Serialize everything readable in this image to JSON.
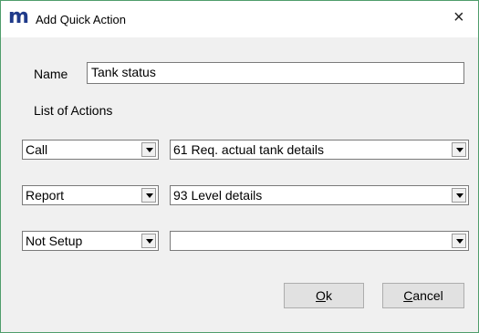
{
  "window": {
    "title": "Add Quick Action",
    "logo_letter": "m",
    "close_glyph": "×"
  },
  "form": {
    "name_label": "Name",
    "name_value": "Tank status",
    "list_label": "List of Actions"
  },
  "actions": [
    {
      "type": "Call",
      "detail": "61  Req. actual tank details"
    },
    {
      "type": "Report",
      "detail": "93  Level details"
    },
    {
      "type": "Not Setup",
      "detail": ""
    }
  ],
  "buttons": {
    "ok": {
      "mnemonic": "O",
      "rest": "k"
    },
    "cancel": {
      "mnemonic": "C",
      "rest": "ancel"
    }
  }
}
